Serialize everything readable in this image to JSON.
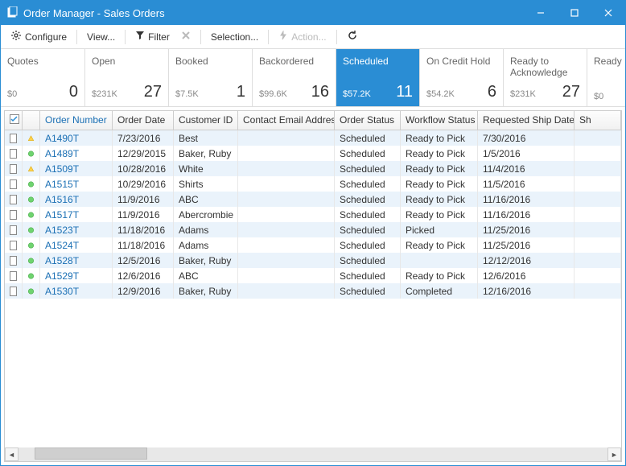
{
  "window": {
    "title": "Order Manager - Sales Orders"
  },
  "toolbar": {
    "configure": "Configure",
    "view": "View...",
    "filter": "Filter",
    "selection": "Selection...",
    "action": "Action..."
  },
  "statuses": [
    {
      "label": "Quotes",
      "amount": "$0",
      "count": "0",
      "active": false
    },
    {
      "label": "Open",
      "amount": "$231K",
      "count": "27",
      "active": false
    },
    {
      "label": "Booked",
      "amount": "$7.5K",
      "count": "1",
      "active": false
    },
    {
      "label": "Backordered",
      "amount": "$99.6K",
      "count": "16",
      "active": false
    },
    {
      "label": "Scheduled",
      "amount": "$57.2K",
      "count": "11",
      "active": true
    },
    {
      "label": "On Credit Hold",
      "amount": "$54.2K",
      "count": "6",
      "active": false
    },
    {
      "label": "Ready to Acknowledge",
      "amount": "$231K",
      "count": "27",
      "active": false
    },
    {
      "label": "Ready Payme",
      "amount": "$0",
      "count": "",
      "active": false
    }
  ],
  "columns": [
    "Order Number",
    "Order Date",
    "Customer ID",
    "Contact Email Address",
    "Order Status",
    "Workflow Status",
    "Requested Ship Date",
    "Sh"
  ],
  "rows": [
    {
      "icon": "warn",
      "order": "A1490T",
      "date": "7/23/2016",
      "cust": "Best",
      "email": "",
      "ostat": "Scheduled",
      "wstat": "Ready to Pick",
      "ship": "7/30/2016"
    },
    {
      "icon": "ok",
      "order": "A1489T",
      "date": "12/29/2015",
      "cust": "Baker, Ruby",
      "email": "",
      "ostat": "Scheduled",
      "wstat": "Ready to Pick",
      "ship": "1/5/2016"
    },
    {
      "icon": "warn",
      "order": "A1509T",
      "date": "10/28/2016",
      "cust": "White",
      "email": "",
      "ostat": "Scheduled",
      "wstat": "Ready to Pick",
      "ship": "11/4/2016"
    },
    {
      "icon": "ok",
      "order": "A1515T",
      "date": "10/29/2016",
      "cust": "Shirts",
      "email": "",
      "ostat": "Scheduled",
      "wstat": "Ready to Pick",
      "ship": "11/5/2016"
    },
    {
      "icon": "ok",
      "order": "A1516T",
      "date": "11/9/2016",
      "cust": "ABC",
      "email": "",
      "ostat": "Scheduled",
      "wstat": "Ready to Pick",
      "ship": "11/16/2016"
    },
    {
      "icon": "ok",
      "order": "A1517T",
      "date": "11/9/2016",
      "cust": "Abercrombie",
      "email": "",
      "ostat": "Scheduled",
      "wstat": "Ready to Pick",
      "ship": "11/16/2016"
    },
    {
      "icon": "ok",
      "order": "A1523T",
      "date": "11/18/2016",
      "cust": "Adams",
      "email": "",
      "ostat": "Scheduled",
      "wstat": "Picked",
      "ship": "11/25/2016"
    },
    {
      "icon": "ok",
      "order": "A1524T",
      "date": "11/18/2016",
      "cust": "Adams",
      "email": "",
      "ostat": "Scheduled",
      "wstat": "Ready to Pick",
      "ship": "11/25/2016"
    },
    {
      "icon": "ok",
      "order": "A1528T",
      "date": "12/5/2016",
      "cust": "Baker, Ruby",
      "email": "",
      "ostat": "Scheduled",
      "wstat": "",
      "ship": "12/12/2016"
    },
    {
      "icon": "ok",
      "order": "A1529T",
      "date": "12/6/2016",
      "cust": "ABC",
      "email": "",
      "ostat": "Scheduled",
      "wstat": "Ready to Pick",
      "ship": "12/6/2016"
    },
    {
      "icon": "ok",
      "order": "A1530T",
      "date": "12/9/2016",
      "cust": "Baker, Ruby",
      "email": "",
      "ostat": "Scheduled",
      "wstat": "Completed",
      "ship": "12/16/2016"
    }
  ]
}
